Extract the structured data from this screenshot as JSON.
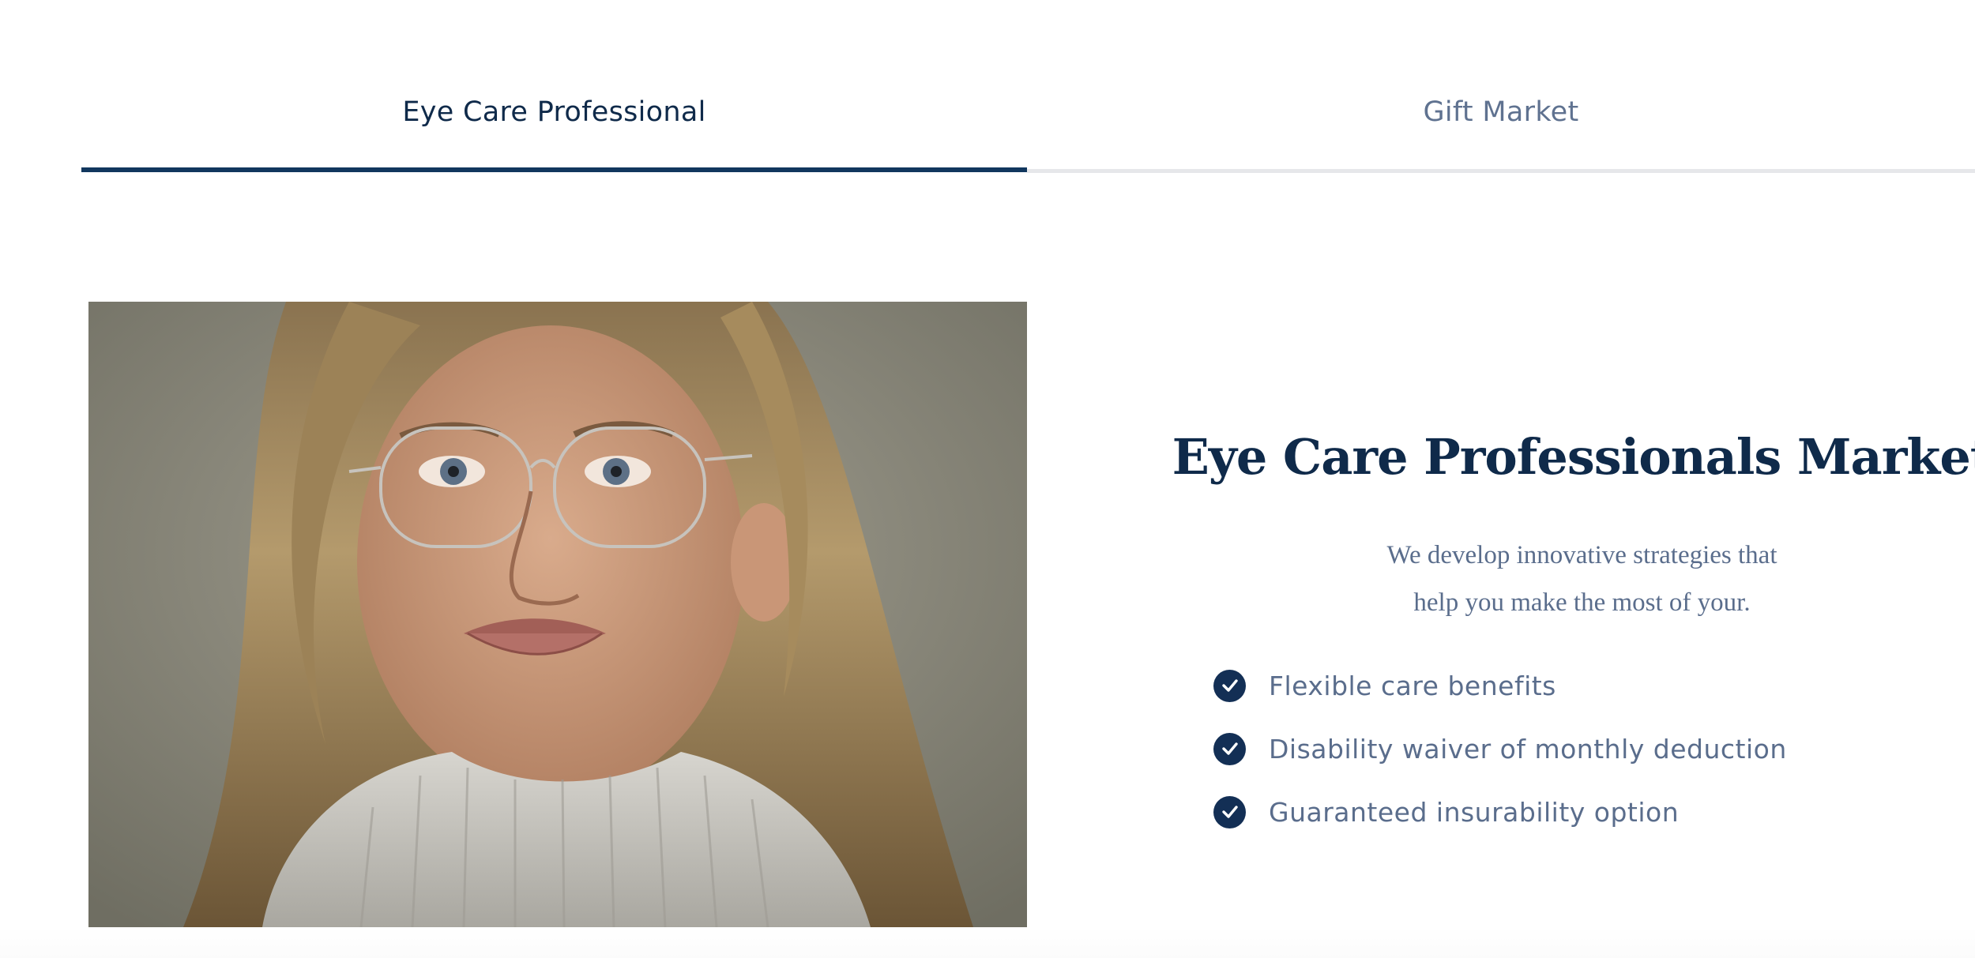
{
  "tabs": [
    {
      "label": "Eye Care Professional",
      "active": true
    },
    {
      "label": "Gift Market",
      "active": false
    }
  ],
  "hero_image": {
    "alt": "Woman wearing rimless eyeglasses and a grey turtleneck sweater"
  },
  "content": {
    "heading": "Eye Care Professionals Market",
    "subtitle_line1": "We develop innovative strategies that",
    "subtitle_line2": "help you make the most of your.",
    "features": [
      {
        "label": "Flexible care benefits",
        "icon": "check-circle-icon"
      },
      {
        "label": "Disability waiver of monthly deduction",
        "icon": "check-circle-icon"
      },
      {
        "label": "Guaranteed insurability option",
        "icon": "check-circle-icon"
      }
    ]
  },
  "colors": {
    "navy": "#0f2a4a",
    "tab_active_underline": "#11375e",
    "muted_text": "#5a6d8c",
    "tab_inactive_underline": "#e6e7ea"
  }
}
